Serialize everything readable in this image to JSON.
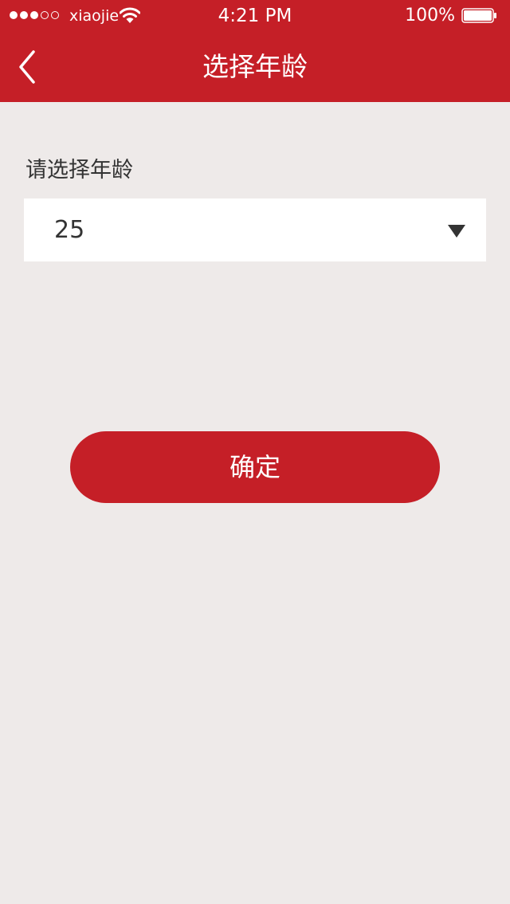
{
  "status_bar": {
    "carrier": "xiaojie",
    "time": "4:21 PM",
    "battery": "100%",
    "signal_strength": "3 of 5"
  },
  "nav": {
    "title": "选择年龄",
    "back_icon": "chevron-left-icon"
  },
  "form": {
    "label": "请选择年龄",
    "selected_age": "25",
    "dropdown_icon": "caret-down-icon"
  },
  "confirm_label": "确定",
  "colors": {
    "brand_red": "#c51f27",
    "background": "#eeeae9",
    "text_dark": "#333333"
  }
}
